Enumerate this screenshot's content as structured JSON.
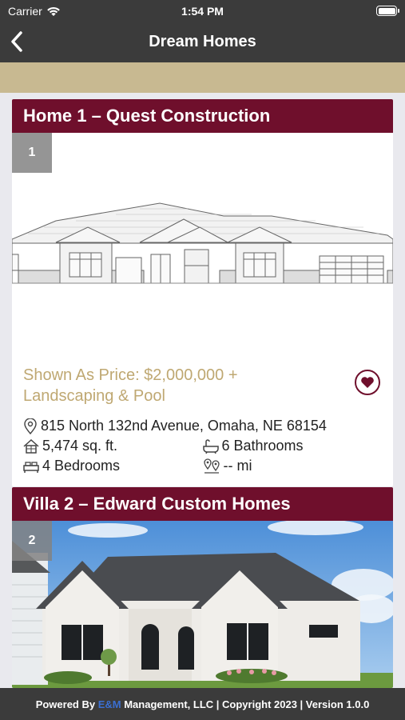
{
  "status_bar": {
    "carrier": "Carrier",
    "time": "1:54 PM"
  },
  "nav": {
    "title": "Dream Homes",
    "back_icon": "chevron-left-icon"
  },
  "listings": [
    {
      "title": "Home 1 – Quest Construction",
      "number": "1",
      "price": "Shown As Price: $2,000,000 + Landscaping & Pool",
      "address": "815 North 132nd Avenue, Omaha, NE 68154",
      "sqft": "5,474 sq. ft.",
      "bathrooms": "6 Bathrooms",
      "bedrooms": "4 Bedrooms",
      "distance": "-- mi",
      "favorite_icon": "heart-icon"
    },
    {
      "title": "Villa 2 – Edward Custom Homes",
      "number": "2"
    }
  ],
  "footer": {
    "prefix": "Powered By ",
    "brand": "E&M",
    "suffix": " Management, LLC | Copyright 2023 | Version 1.0.0"
  },
  "colors": {
    "maroon": "#6f0f2c",
    "gold": "#c8b991",
    "dark": "#3b3b3b"
  }
}
